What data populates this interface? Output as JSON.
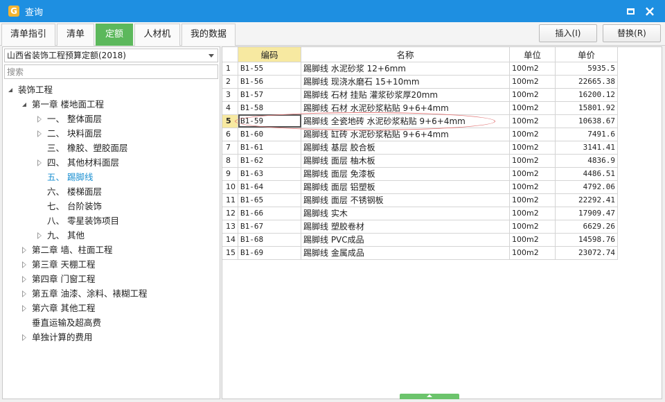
{
  "window": {
    "title": "查询",
    "app_icon_glyph": "G"
  },
  "tabs": [
    {
      "label": "清单指引",
      "active": false
    },
    {
      "label": "清单",
      "active": false
    },
    {
      "label": "定额",
      "active": true
    },
    {
      "label": "人材机",
      "active": false
    },
    {
      "label": "我的数据",
      "active": false
    }
  ],
  "toolbar": {
    "insert_label": "插入(I)",
    "replace_label": "替换(R)"
  },
  "left": {
    "quota_select_value": "山西省装饰工程预算定额(2018)",
    "search_placeholder": "搜索"
  },
  "tree": [
    {
      "label": "装饰工程",
      "level": 0,
      "state": "open"
    },
    {
      "label": "第一章 楼地面工程",
      "level": 1,
      "state": "open"
    },
    {
      "label": "一、 整体面层",
      "level": 2,
      "state": "closed"
    },
    {
      "label": "二、 块料面层",
      "level": 2,
      "state": "closed"
    },
    {
      "label": "三、 橡胶、塑胶面层",
      "level": 2,
      "state": "leaf"
    },
    {
      "label": "四、 其他材料面层",
      "level": 2,
      "state": "closed"
    },
    {
      "label": "五、 踢脚线",
      "level": 2,
      "state": "leaf",
      "selected": true
    },
    {
      "label": "六、 楼梯面层",
      "level": 2,
      "state": "leaf"
    },
    {
      "label": "七、 台阶装饰",
      "level": 2,
      "state": "leaf"
    },
    {
      "label": "八、 零星装饰项目",
      "level": 2,
      "state": "leaf"
    },
    {
      "label": "九、 其他",
      "level": 2,
      "state": "closed"
    },
    {
      "label": "第二章 墙、柱面工程",
      "level": 1,
      "state": "closed"
    },
    {
      "label": "第三章 天棚工程",
      "level": 1,
      "state": "closed"
    },
    {
      "label": "第四章 门窗工程",
      "level": 1,
      "state": "closed"
    },
    {
      "label": "第五章 油漆、涂料、裱糊工程",
      "level": 1,
      "state": "closed"
    },
    {
      "label": "第六章 其他工程",
      "level": 1,
      "state": "closed"
    },
    {
      "label": "垂直运输及超高费",
      "level": 1,
      "state": "leaf"
    },
    {
      "label": "单独计算的费用",
      "level": 1,
      "state": "closed"
    }
  ],
  "table": {
    "headers": {
      "code": "编码",
      "name": "名称",
      "unit": "单位",
      "price": "单价"
    },
    "selected_row": 5,
    "rows": [
      {
        "no": "1",
        "code": "B1-55",
        "name": "踢脚线 水泥砂浆 12+6mm",
        "unit": "100m2",
        "price": "5935.5"
      },
      {
        "no": "2",
        "code": "B1-56",
        "name": "踢脚线 现浇水磨石 15+10mm",
        "unit": "100m2",
        "price": "22665.38"
      },
      {
        "no": "3",
        "code": "B1-57",
        "name": "踢脚线 石材 挂贴 灌浆砂浆厚20mm",
        "unit": "100m2",
        "price": "16200.12"
      },
      {
        "no": "4",
        "code": "B1-58",
        "name": "踢脚线 石材 水泥砂浆粘贴 9+6+4mm",
        "unit": "100m2",
        "price": "15801.92"
      },
      {
        "no": "5",
        "code": "B1-59",
        "name": "踢脚线 全瓷地砖 水泥砂浆粘贴 9+6+4mm",
        "unit": "100m2",
        "price": "10638.67"
      },
      {
        "no": "6",
        "code": "B1-60",
        "name": "踢脚线 缸砖 水泥砂浆粘贴 9+6+4mm",
        "unit": "100m2",
        "price": "7491.6"
      },
      {
        "no": "7",
        "code": "B1-61",
        "name": "踢脚线 基层 胶合板",
        "unit": "100m2",
        "price": "3141.41"
      },
      {
        "no": "8",
        "code": "B1-62",
        "name": "踢脚线 面层 柚木板",
        "unit": "100m2",
        "price": "4836.9"
      },
      {
        "no": "9",
        "code": "B1-63",
        "name": "踢脚线 面层 免漆板",
        "unit": "100m2",
        "price": "4486.51"
      },
      {
        "no": "10",
        "code": "B1-64",
        "name": "踢脚线 面层 铝塑板",
        "unit": "100m2",
        "price": "4792.06"
      },
      {
        "no": "11",
        "code": "B1-65",
        "name": "踢脚线 面层 不锈钢板",
        "unit": "100m2",
        "price": "22292.41"
      },
      {
        "no": "12",
        "code": "B1-66",
        "name": "踢脚线 实木",
        "unit": "100m2",
        "price": "17909.47"
      },
      {
        "no": "13",
        "code": "B1-67",
        "name": "踢脚线 塑胶卷材",
        "unit": "100m2",
        "price": "6629.26"
      },
      {
        "no": "14",
        "code": "B1-68",
        "name": "踢脚线 PVC成品",
        "unit": "100m2",
        "price": "14598.76"
      },
      {
        "no": "15",
        "code": "B1-69",
        "name": "踢脚线 金属成品",
        "unit": "100m2",
        "price": "23072.74"
      }
    ]
  },
  "colors": {
    "titlebar": "#1e8fe1",
    "active_tab": "#5cb85c",
    "highlight": "#f7e9a1",
    "selected_tree": "#1a8fd1",
    "annotation": "#e07070"
  },
  "icons": {
    "maximize": "maximize-icon",
    "close": "close-icon",
    "dropdown": "chevron-down-icon",
    "expand": "triangle-right-icon",
    "collapse": "triangle-down-icon"
  }
}
